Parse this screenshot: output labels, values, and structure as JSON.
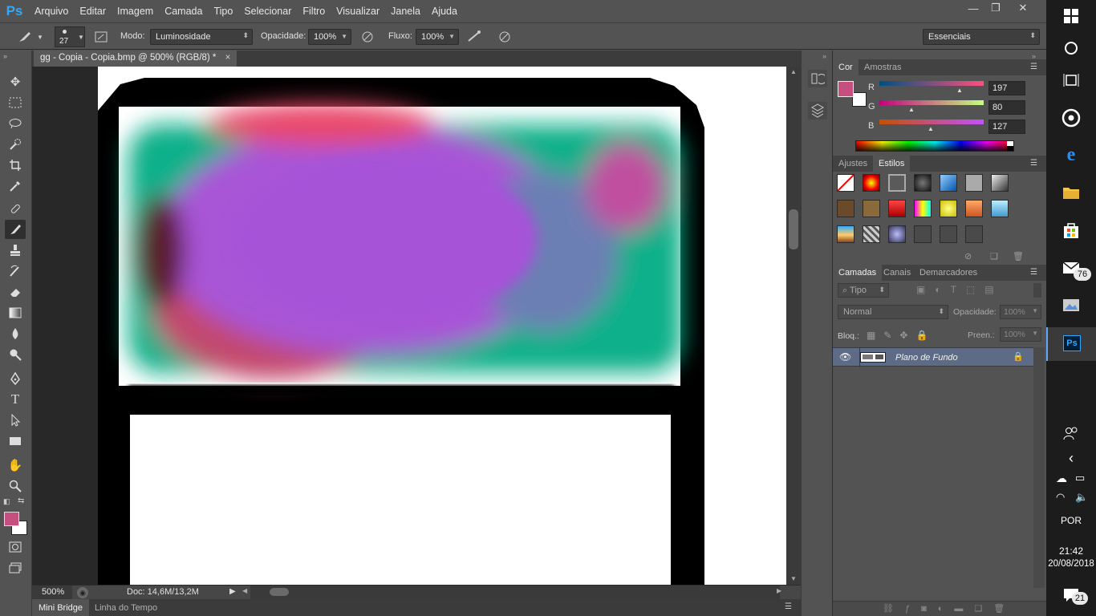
{
  "app": {
    "logo": "Ps"
  },
  "menu": [
    "Arquivo",
    "Editar",
    "Imagem",
    "Camada",
    "Tipo",
    "Selecionar",
    "Filtro",
    "Visualizar",
    "Janela",
    "Ajuda"
  ],
  "window_controls": {
    "minimize": "—",
    "restore": "❐",
    "close": "✕"
  },
  "options": {
    "brush_size": "27",
    "mode_label": "Modo:",
    "mode_value": "Luminosidade",
    "opacity_label": "Opacidade:",
    "opacity_value": "100%",
    "flow_label": "Fluxo:",
    "flow_value": "100%",
    "workspace": "Essenciais"
  },
  "document": {
    "tab_title": "gg - Copia - Copia.bmp @ 500% (RGB/8) *",
    "zoom": "500%",
    "doc_info": "Doc: 14,6M/13,2M"
  },
  "bottom_tabs": [
    "Mini Bridge",
    "Linha do Tempo"
  ],
  "color_panel": {
    "tabs": [
      "Cor",
      "Amostras"
    ],
    "r_label": "R",
    "r_value": "197",
    "g_label": "G",
    "g_value": "80",
    "b_label": "B",
    "b_value": "127",
    "foreground": "#c5507f",
    "background": "#ffffff"
  },
  "styles_panel": {
    "tabs": [
      "Ajustes",
      "Estilos"
    ]
  },
  "layers_panel": {
    "tabs": [
      "Camadas",
      "Canais",
      "Demarcadores"
    ],
    "filter_label": "Tipo",
    "blend_mode": "Normal",
    "opacity_label": "Opacidade:",
    "opacity_value": "100%",
    "lock_label": "Bloq.:",
    "fill_label": "Preen.:",
    "fill_value": "100%",
    "layers": [
      {
        "name": "Plano de Fundo",
        "visible": true,
        "locked": true
      }
    ]
  },
  "taskbar": {
    "mail_badge": "76",
    "language": "POR",
    "time": "21:42",
    "date": "20/08/2018",
    "notif_count": "21"
  }
}
